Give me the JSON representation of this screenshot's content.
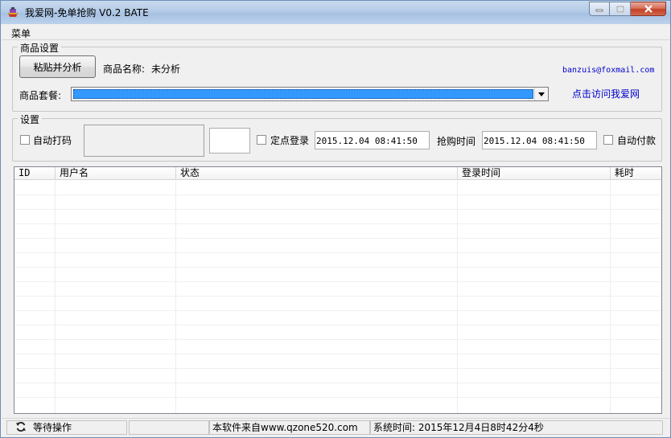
{
  "window": {
    "title": "我爱网-免单抢购 V0.2 BATE"
  },
  "menu": {
    "items": [
      "菜单"
    ]
  },
  "product_group": {
    "label": "商品设置",
    "paste_button": "粘贴并分析",
    "name_label": "商品名称:",
    "name_value": "未分析",
    "email": "banzuis@foxmail.com",
    "package_label": "商品套餐:",
    "visit_link": "点击访问我爱网"
  },
  "settings_group": {
    "label": "设置",
    "auto_captcha": "自动打码",
    "timed_login": "定点登录",
    "login_datetime": "2015.12.04 08:41:50",
    "purchase_time_label": "抢购时间",
    "purchase_datetime": "2015.12.04 08:41:50",
    "auto_pay": "自动付款"
  },
  "table": {
    "columns": [
      "ID",
      "用户名",
      "状态",
      "登录时间",
      "耗时"
    ]
  },
  "statusbar": {
    "status": "等待操作",
    "software_source": "本软件来自www.qzone520.com",
    "system_time": "系统时间: 2015年12月4日8时42分4秒"
  },
  "colors": {
    "selection": "#3399ff",
    "link": "#0000cc",
    "close_button": "#c44126"
  },
  "icons": [
    "app-icon",
    "minimize-icon",
    "maximize-icon",
    "close-icon",
    "chevron-down-icon",
    "refresh-icon"
  ]
}
